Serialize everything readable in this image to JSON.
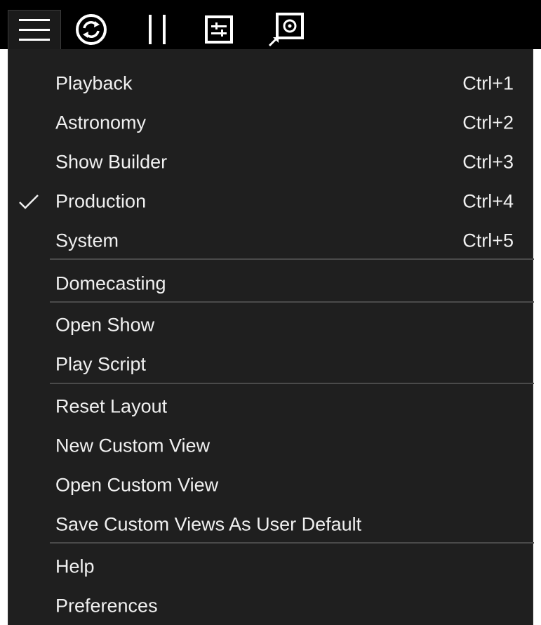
{
  "toolbar": {
    "icons": [
      "hamburger-menu-icon",
      "sync-icon",
      "pause-icon",
      "sliders-icon",
      "screen-capture-icon"
    ]
  },
  "menu": {
    "items": [
      {
        "label": "Playback",
        "shortcut": "Ctrl+1",
        "checked": false
      },
      {
        "label": "Astronomy",
        "shortcut": "Ctrl+2",
        "checked": false
      },
      {
        "label": "Show Builder",
        "shortcut": "Ctrl+3",
        "checked": false
      },
      {
        "label": "Production",
        "shortcut": "Ctrl+4",
        "checked": true
      },
      {
        "label": "System",
        "shortcut": "Ctrl+5",
        "checked": false
      },
      {
        "label": "Domecasting",
        "shortcut": "",
        "checked": false
      },
      {
        "label": "Open Show",
        "shortcut": "",
        "checked": false
      },
      {
        "label": "Play Script",
        "shortcut": "",
        "checked": false
      },
      {
        "label": "Reset Layout",
        "shortcut": "",
        "checked": false
      },
      {
        "label": "New Custom View",
        "shortcut": "",
        "checked": false
      },
      {
        "label": "Open Custom View",
        "shortcut": "",
        "checked": false
      },
      {
        "label": "Save Custom Views As User Default",
        "shortcut": "",
        "checked": false
      },
      {
        "label": "Help",
        "shortcut": "",
        "checked": false
      },
      {
        "label": "Preferences",
        "shortcut": "",
        "checked": false
      }
    ]
  },
  "colors": {
    "toolbar_bg": "#000000",
    "menu_bg": "#1f1f1f",
    "text": "#f0f0f0",
    "separator": "#4a4a4a"
  }
}
